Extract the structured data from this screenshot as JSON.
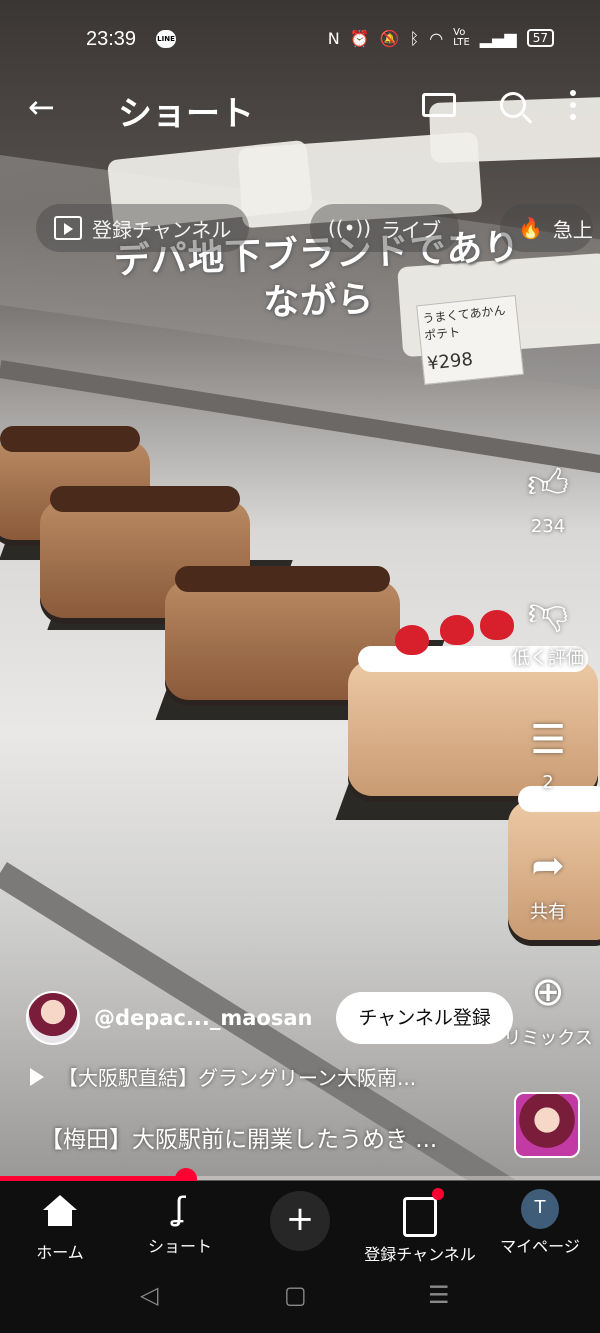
{
  "status_bar": {
    "time": "23:39",
    "line_icon": "LINE",
    "battery": "57",
    "icons": [
      "nfc-icon",
      "alarm-icon",
      "mute-icon",
      "bluetooth-icon",
      "wifi-icon",
      "volte-icon",
      "signal-icon"
    ]
  },
  "header": {
    "title": "ショート",
    "icons": [
      "back-icon",
      "cast-icon",
      "search-icon",
      "more-icon"
    ]
  },
  "chips": {
    "subscriptions": "登録チャンネル",
    "live": "ライブ",
    "trending": "急上"
  },
  "video": {
    "caption": "デパ地下ブランドでありながら",
    "price_card_text": "うまくてあかんポテト",
    "price_card_price": "¥298"
  },
  "actions": {
    "like_count": "234",
    "dislike_label": "低く評価",
    "comment_count": "2",
    "share_label": "共有",
    "remix_label": "リミックス"
  },
  "channel": {
    "handle": "@depac..._maosan",
    "subscribe_label": "チャンネル登録"
  },
  "related": {
    "text": "【大阪駅直結】グラングリーン大阪南..."
  },
  "video_title": "【梅田】大阪駅前に開業したうめき ...",
  "progress": {
    "played_fraction": 0.31
  },
  "bottom_nav": {
    "home": "ホーム",
    "shorts": "ショート",
    "subscriptions": "登録チャンネル",
    "me": "マイページ",
    "me_initial": "T"
  },
  "colors": {
    "accent": "#ff0033",
    "nav_bg": "#0f0f0f",
    "create_bg": "#272727",
    "avatar_bg": "#3f5d78"
  }
}
